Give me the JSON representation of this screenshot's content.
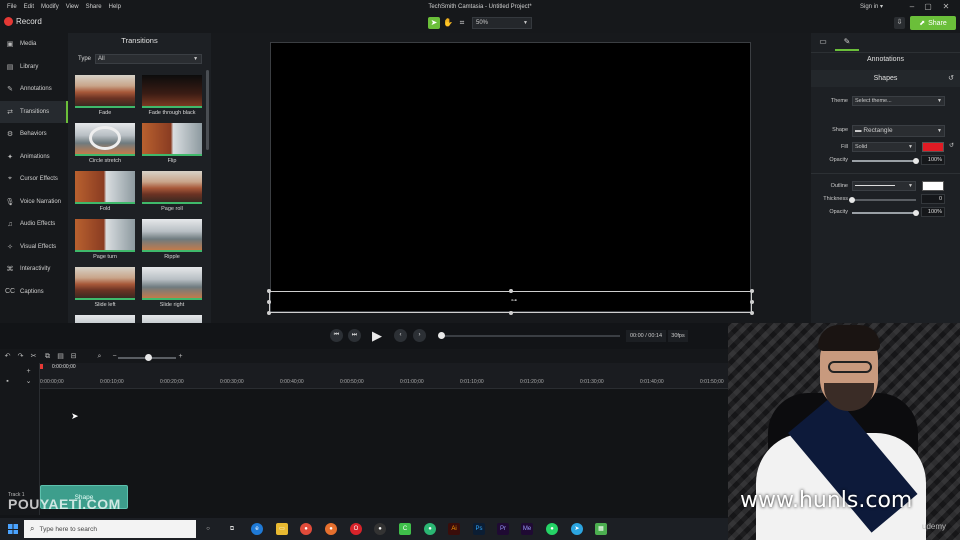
{
  "menu": [
    "File",
    "Edit",
    "Modify",
    "View",
    "Share",
    "Help"
  ],
  "app_title": "TechSmith Camtasia - Untitled Project*",
  "signin": "Sign in ▾",
  "toolbar": {
    "record_label": "Record",
    "zoom_value": "50%",
    "share_label": "Share"
  },
  "sidebar": {
    "items": [
      {
        "label": "Media",
        "icon": "media-icon"
      },
      {
        "label": "Library",
        "icon": "library-icon"
      },
      {
        "label": "Annotations",
        "icon": "annotations-icon"
      },
      {
        "label": "Transitions",
        "icon": "transitions-icon"
      },
      {
        "label": "Behaviors",
        "icon": "behaviors-icon"
      },
      {
        "label": "Animations",
        "icon": "animations-icon"
      },
      {
        "label": "Cursor Effects",
        "icon": "cursor-effects-icon"
      },
      {
        "label": "Voice Narration",
        "icon": "microphone-icon"
      },
      {
        "label": "Audio Effects",
        "icon": "audio-effects-icon"
      },
      {
        "label": "Visual Effects",
        "icon": "visual-effects-icon"
      },
      {
        "label": "Interactivity",
        "icon": "interactivity-icon"
      },
      {
        "label": "Captions",
        "icon": "captions-icon"
      }
    ],
    "active_index": 3
  },
  "transitions": {
    "title": "Transitions",
    "type_label": "Type",
    "type_value": "All",
    "items": [
      "Fade",
      "Fade through black",
      "Circle stretch",
      "Flip",
      "Fold",
      "Page roll",
      "Page turn",
      "Ripple",
      "Slide left",
      "Slide right"
    ]
  },
  "props": {
    "title": "Annotations",
    "subtitle": "Shapes",
    "theme_label": "Theme",
    "theme_value": "Select theme...",
    "shape_label": "Shape",
    "shape_value": "Rectangle",
    "fill_label": "Fill",
    "fill_value": "Solid",
    "fill_color": "#e01b24",
    "opacity_label": "Opacity",
    "fill_opacity": "100%",
    "fill_opacity_level": 1.0,
    "outline_label": "Outline",
    "outline_color": "#ffffff",
    "thickness_label": "Thickness",
    "thickness_value": "0",
    "thickness_level": 0.0,
    "outline_opacity": "100%",
    "outline_opacity_level": 1.0
  },
  "playback": {
    "time": "00:00 / 00:14",
    "fps": "30fps",
    "progress": 0.0
  },
  "timeline": {
    "playhead": "0:00:00;00",
    "ticks": [
      "0:00:00;00",
      "0:00:10;00",
      "0:00:20;00",
      "0:00:30;00",
      "0:00:40;00",
      "0:00:50;00",
      "0:01:00;00",
      "0:01:10;00",
      "0:01:20;00",
      "0:01:30;00",
      "0:01:40;00",
      "0:01:50;00"
    ],
    "track_label": "Track 1",
    "clip_label": "Shape"
  },
  "watermarks": {
    "url": "www.hunls.com",
    "udemy": "udemy",
    "pouya": "POUYAETI.COM"
  },
  "taskbar": {
    "search_placeholder": "Type here to search"
  },
  "colors": {
    "accent": "#6bbf3a",
    "record": "#e53935",
    "clip": "#3d9e8c"
  }
}
